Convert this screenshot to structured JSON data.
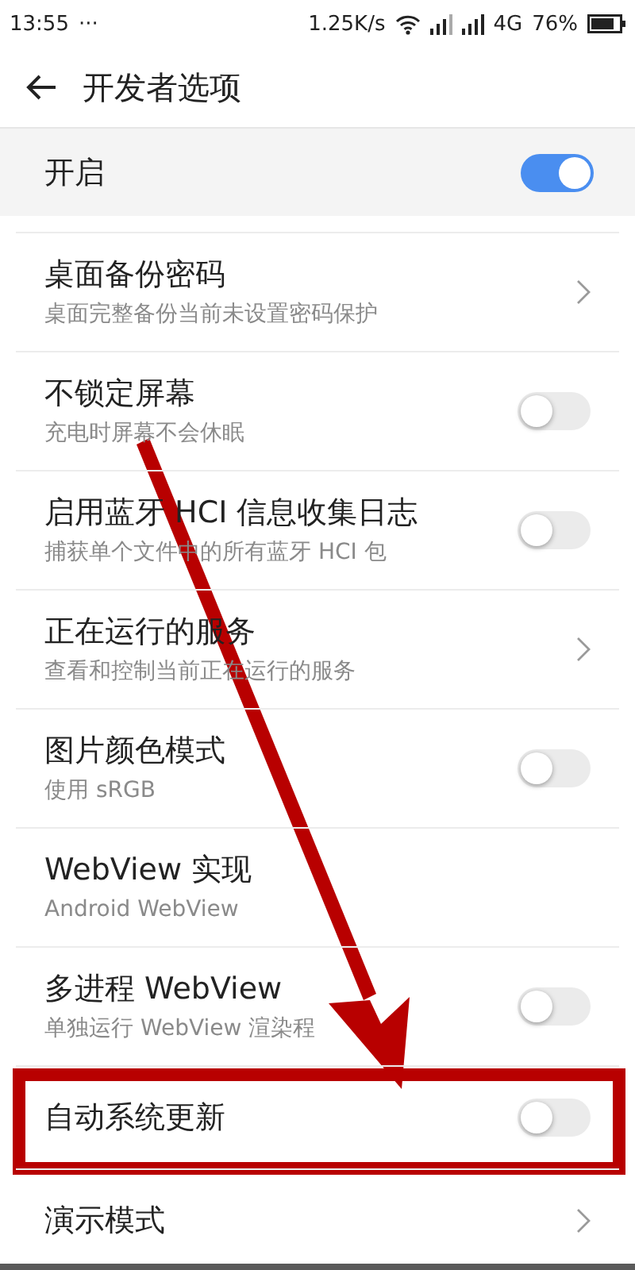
{
  "status_bar": {
    "time": "13:55",
    "more": "···",
    "speed": "1.25K/s",
    "network": "4G",
    "battery": "76%"
  },
  "toolbar": {
    "title": "开发者选项"
  },
  "master": {
    "label": "开启",
    "on": true
  },
  "items": [
    {
      "kind": "link",
      "title": "桌面备份密码",
      "subtitle": "桌面完整备份当前未设置密码保护",
      "highlighted": false
    },
    {
      "kind": "switch",
      "title": "不锁定屏幕",
      "subtitle": "充电时屏幕不会休眠",
      "on": false,
      "highlighted": false
    },
    {
      "kind": "switch",
      "title": "启用蓝牙 HCI 信息收集日志",
      "subtitle": "捕获单个文件中的所有蓝牙 HCI 包",
      "on": false,
      "highlighted": false
    },
    {
      "kind": "link",
      "title": "正在运行的服务",
      "subtitle": "查看和控制当前正在运行的服务",
      "highlighted": false
    },
    {
      "kind": "switch",
      "title": "图片颜色模式",
      "subtitle": "使用 sRGB",
      "on": false,
      "highlighted": false
    },
    {
      "kind": "link-plain",
      "title": "WebView 实现",
      "subtitle": "Android WebView",
      "highlighted": false
    },
    {
      "kind": "switch",
      "title": "多进程 WebView",
      "subtitle": "单独运行 WebView 渲染程",
      "on": false,
      "highlighted": false
    },
    {
      "kind": "switch",
      "title": "自动系统更新",
      "on": false,
      "highlighted": true
    },
    {
      "kind": "link",
      "title": "演示模式",
      "highlighted": false
    }
  ]
}
